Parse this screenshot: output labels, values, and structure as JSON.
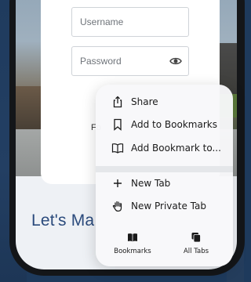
{
  "login": {
    "username_placeholder": "Username",
    "password_placeholder": "Password",
    "forgot_fragment": "Fo",
    "headline_fragment": "Let's Ma"
  },
  "menu": {
    "items": [
      {
        "label": "Share",
        "icon": "share-icon"
      },
      {
        "label": "Add to Bookmarks",
        "icon": "bookmark-icon"
      },
      {
        "label": "Add Bookmark to...",
        "icon": "book-icon"
      },
      {
        "label": "New Tab",
        "icon": "plus-icon"
      },
      {
        "label": "New Private Tab",
        "icon": "hand-icon"
      }
    ],
    "toolbar": [
      {
        "label": "Bookmarks",
        "icon": "bookmarks-book-icon"
      },
      {
        "label": "All Tabs",
        "icon": "tabs-icon"
      }
    ]
  },
  "colors": {
    "headline": "#2a4a7c",
    "background": "#1e3a5c"
  }
}
